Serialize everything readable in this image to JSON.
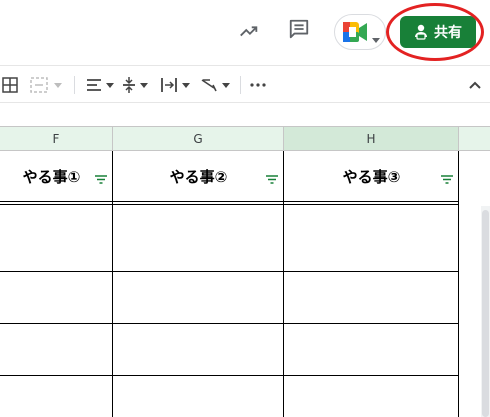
{
  "header": {
    "share_label": "共有"
  },
  "columns": {
    "F": "F",
    "G": "G",
    "H": "H"
  },
  "sheet": {
    "header_cells": [
      "やる事①",
      "やる事②",
      "やる事③"
    ]
  },
  "colors": {
    "share_green": "#188038",
    "highlight_red": "#e32222",
    "selected_column_bg": "#d3e9d8",
    "column_header_bg": "#e6f4ea"
  },
  "icons": {
    "trend": "trend-icon",
    "comments": "comment-icon",
    "meet": "meet-icon",
    "share": "person-lock-icon",
    "collapse": "chevron-up-icon"
  }
}
